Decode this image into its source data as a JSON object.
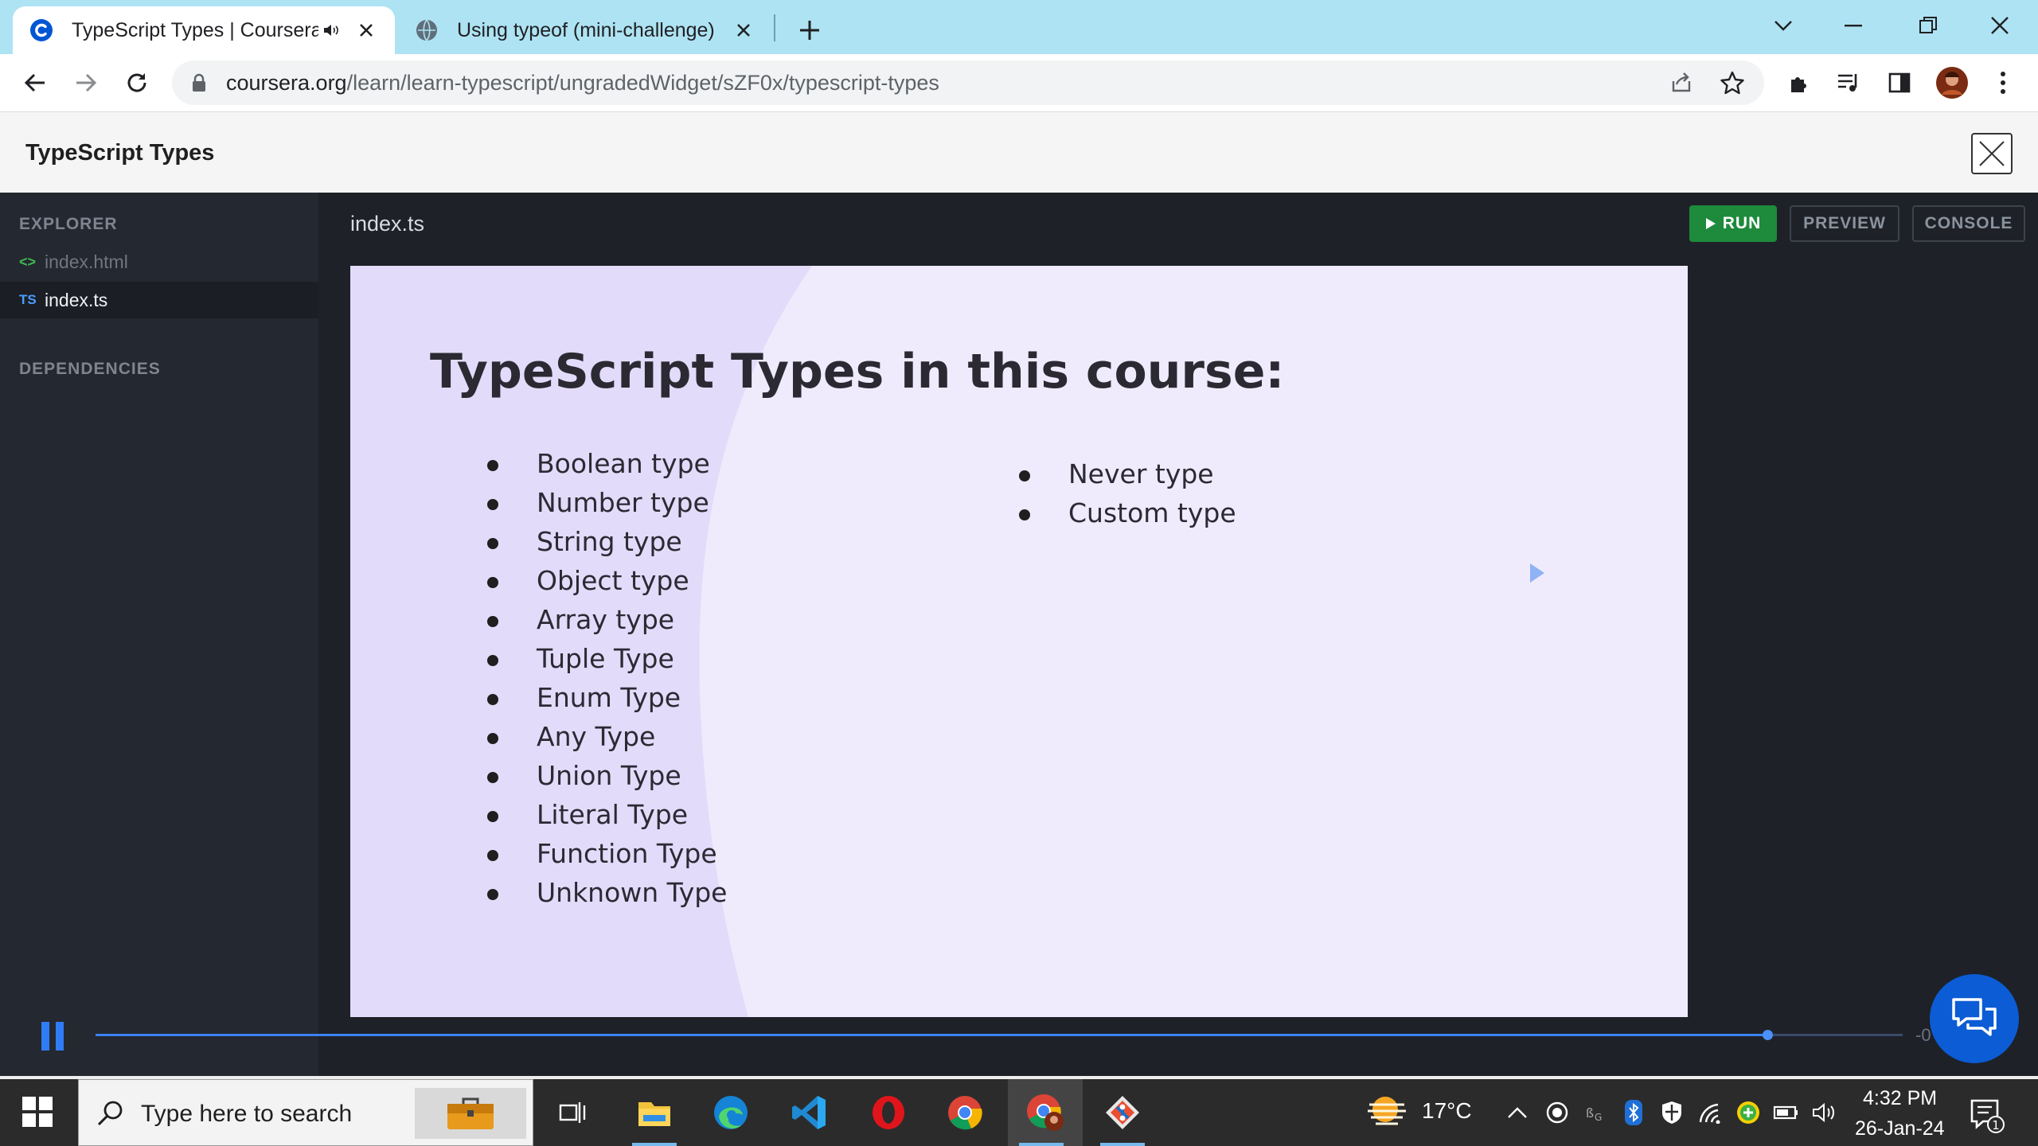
{
  "browser": {
    "tabs": [
      {
        "title": "TypeScript Types | Coursera",
        "favicon": "coursera-icon",
        "active": true,
        "audio": true
      },
      {
        "title": "Using typeof (mini-challenge)",
        "favicon": "globe-icon",
        "active": false,
        "audio": false
      }
    ],
    "url_host": "coursera.org",
    "url_path": "/learn/learn-typescript/ungradedWidget/sZF0x/typescript-types"
  },
  "page": {
    "title": "TypeScript Types"
  },
  "sidebar": {
    "explorer_heading": "EXPLORER",
    "files": [
      {
        "icon": "<>",
        "name": "index.html",
        "active": false
      },
      {
        "icon": "TS",
        "name": "index.ts",
        "active": true
      }
    ],
    "dependencies_heading": "DEPENDENCIES"
  },
  "editor": {
    "file_tab": "index.ts",
    "run_label": "RUN",
    "preview_label": "PREVIEW",
    "console_label": "CONSOLE"
  },
  "slide": {
    "title": "TypeScript Types in this course:",
    "left_items": [
      "Boolean type",
      "Number type",
      "String type",
      "Object type",
      "Array type",
      "Tuple Type",
      "Enum Type",
      "Any Type",
      "Union Type",
      "Literal Type",
      "Function Type",
      "Unknown Type"
    ],
    "right_items": [
      "Never type",
      "Custom type"
    ]
  },
  "player": {
    "progress": 0.925,
    "time_remaining": "-0"
  },
  "taskbar": {
    "search_placeholder": "Type here to search",
    "weather": "17°C",
    "time": "4:32 PM",
    "date": "26-Jan-24",
    "notification_count": "1"
  },
  "colors": {
    "tab_strip": "#aee3f3",
    "run_green": "#1e8a3c",
    "slide_bg": "#ede8fb",
    "accent_blue": "#0b5cd5"
  }
}
